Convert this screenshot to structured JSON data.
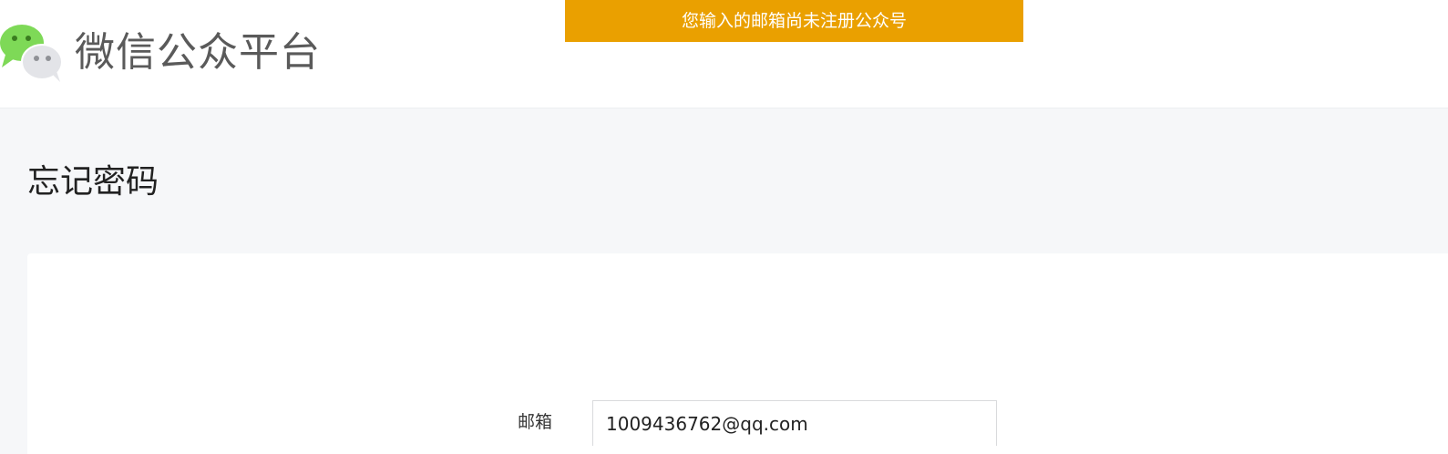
{
  "header": {
    "brand_title": "微信公众平台",
    "logo_icon": "wechat-logo-icon"
  },
  "toast": {
    "message": "您输入的邮箱尚未注册公众号",
    "color": "#eaa000"
  },
  "page": {
    "title": "忘记密码"
  },
  "form": {
    "email_label": "邮箱",
    "email_value": "1009436762@qq.com"
  }
}
